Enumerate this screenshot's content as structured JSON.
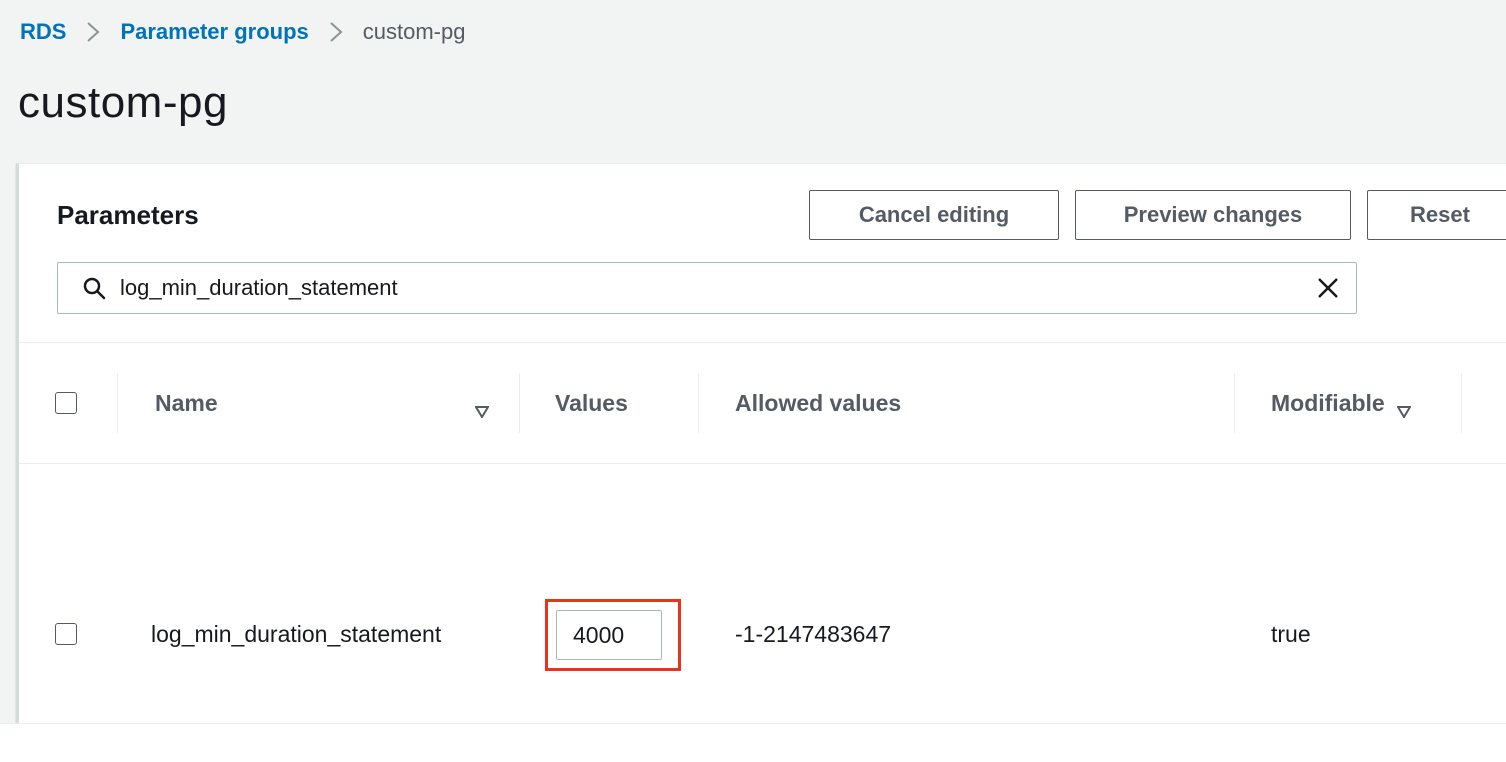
{
  "breadcrumb": {
    "items": [
      {
        "label": "RDS",
        "link": true
      },
      {
        "label": "Parameter groups",
        "link": true
      },
      {
        "label": "custom-pg",
        "link": false
      }
    ]
  },
  "page": {
    "title": "custom-pg"
  },
  "parameters": {
    "title": "Parameters",
    "actions": {
      "cancel_label": "Cancel editing",
      "preview_label": "Preview changes",
      "reset_label": "Reset"
    },
    "search": {
      "value": "log_min_duration_statement",
      "icon": "search-icon",
      "clear_icon": "close-icon"
    },
    "columns": [
      {
        "label": "Name",
        "sortable": true
      },
      {
        "label": "Values",
        "sortable": false
      },
      {
        "label": "Allowed values",
        "sortable": false
      },
      {
        "label": "Modifiable",
        "sortable": true
      }
    ],
    "rows": [
      {
        "name": "log_min_duration_statement",
        "value": "4000",
        "allowed_values": "-1-2147483647",
        "modifiable": "true"
      }
    ]
  },
  "colors": {
    "link": "#0073bb",
    "highlight": "#e8341c",
    "background": "#f2f3f3"
  }
}
